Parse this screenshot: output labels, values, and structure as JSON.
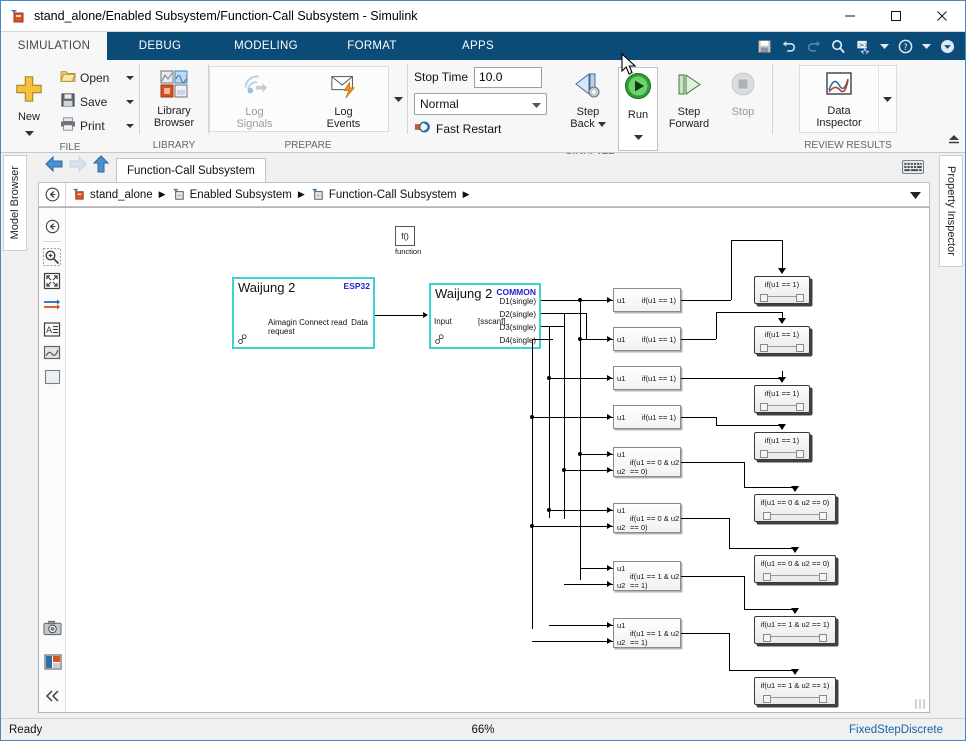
{
  "window": {
    "title": "stand_alone/Enabled Subsystem/Function-Call Subsystem - Simulink",
    "app_icon": "simulink-icon",
    "minimize": "—",
    "maximize": "☐",
    "close": "✕"
  },
  "ribbon": {
    "tabs": [
      {
        "label": "SIMULATION",
        "active": true
      },
      {
        "label": "DEBUG",
        "active": false
      },
      {
        "label": "MODELING",
        "active": false
      },
      {
        "label": "FORMAT",
        "active": false
      },
      {
        "label": "APPS",
        "active": false
      }
    ],
    "quick_access": [
      "save-icon",
      "undo-icon",
      "redo-icon",
      "search-icon",
      "shortcuts-icon",
      "shortcuts-caret",
      "help-icon",
      "help-caret",
      "collapse-ribbon-icon"
    ],
    "groups": [
      {
        "name": "FILE",
        "label": "FILE",
        "big": {
          "label": "New",
          "icon": "new-plus-icon"
        },
        "items": [
          {
            "label": "Open",
            "icon": "folder-open-icon",
            "has_caret": true
          },
          {
            "label": "Save",
            "icon": "floppy-save-icon",
            "has_caret": true
          },
          {
            "label": "Print",
            "icon": "printer-icon",
            "has_caret": true
          }
        ]
      },
      {
        "name": "LIBRARY",
        "label": "LIBRARY",
        "big": {
          "label": "Library\nBrowser",
          "line1": "Library",
          "line2": "Browser",
          "icon": "library-browser-icon"
        }
      },
      {
        "name": "PREPARE",
        "label": "PREPARE",
        "items": [
          {
            "line1": "Log",
            "line2": "Signals",
            "icon": "log-signals-icon",
            "disabled": true
          },
          {
            "line1": "Log",
            "line2": "Events",
            "icon": "log-events-icon",
            "disabled": false
          }
        ],
        "overflow_caret": true
      },
      {
        "name": "SIMULATE",
        "label": "SIMULATE",
        "stop_time_label": "Stop Time",
        "stop_time_value": "10.0",
        "mode_value": "Normal",
        "fast_restart_label": "Fast Restart",
        "buttons": [
          {
            "line1": "Step",
            "line2": "Back",
            "icon": "step-back-icon",
            "has_caret": true,
            "disabled": false
          },
          {
            "line1": "Run",
            "line2": "",
            "icon": "run-icon",
            "has_caret": true,
            "disabled": false,
            "highlight": true
          },
          {
            "line1": "Step",
            "line2": "Forward",
            "icon": "step-forward-icon",
            "has_caret": false,
            "disabled": false
          },
          {
            "line1": "Stop",
            "line2": "",
            "icon": "stop-icon",
            "has_caret": false,
            "disabled": true
          }
        ]
      },
      {
        "name": "REVIEW RESULTS",
        "label": "REVIEW RESULTS",
        "big": {
          "line1": "Data",
          "line2": "Inspector",
          "icon": "data-inspector-icon",
          "has_caret": true
        }
      }
    ]
  },
  "panels": {
    "left_tab": "Model Browser",
    "right_tab": "Property Inspector"
  },
  "nav": {
    "back_icon": "back-arrow-icon",
    "forward_icon": "forward-arrow-icon",
    "up_icon": "up-arrow-icon",
    "document_tab": "Function-Call Subsystem",
    "keyboard_icon": "keyboard-icon",
    "breadcrumb_back_icon": "breadcrumb-back-icon",
    "breadcrumb": [
      {
        "label": "stand_alone",
        "icon": "model-icon"
      },
      {
        "label": "Enabled Subsystem",
        "icon": "subsystem-icon"
      },
      {
        "label": "Function-Call Subsystem",
        "icon": "subsystem-icon"
      }
    ],
    "breadcrumb_caret": "chevron-down-icon"
  },
  "canvas_toolbar": {
    "items": [
      {
        "name": "navigate-up-icon"
      },
      {
        "name": "zoom-in-icon"
      },
      {
        "name": "fit-to-view-icon"
      },
      {
        "name": "signal-lines-icon"
      },
      {
        "name": "annotation-icon"
      },
      {
        "name": "image-icon"
      },
      {
        "name": "area-icon"
      }
    ],
    "bottom_items": [
      {
        "name": "camera-icon"
      },
      {
        "name": "layout-icon"
      },
      {
        "name": "collapse-icon"
      }
    ]
  },
  "diagram": {
    "function_block": {
      "glyph": "f()",
      "label": "function"
    },
    "source_block": {
      "title": "Waijung 2",
      "badge": "ESP32",
      "text": "Aimagin Connect read request",
      "out_port": "Data",
      "link_icon": "library-link-icon"
    },
    "parser_block": {
      "title": "Waijung 2",
      "badge": "COMMON",
      "in_port": "Input",
      "mid": "[sscanf]",
      "out_ports": [
        "D1(single)",
        "D2(single)",
        "D3(single)",
        "D4(single)"
      ],
      "link_icon": "library-link-icon"
    },
    "if_blocks": [
      {
        "ports": [
          "u1"
        ],
        "condition": "if(u1 == 1)"
      },
      {
        "ports": [
          "u1"
        ],
        "condition": "if(u1 == 1)"
      },
      {
        "ports": [
          "u1"
        ],
        "condition": "if(u1 == 1)"
      },
      {
        "ports": [
          "u1"
        ],
        "condition": "if(u1 == 1)"
      },
      {
        "ports": [
          "u1",
          "u2"
        ],
        "condition": "if(u1 == 0 & u2 == 0)"
      },
      {
        "ports": [
          "u1",
          "u2"
        ],
        "condition": "if(u1 == 0 & u2 == 0)"
      },
      {
        "ports": [
          "u1",
          "u2"
        ],
        "condition": "if(u1 == 1 & u2 == 1)"
      },
      {
        "ports": [
          "u1",
          "u2"
        ],
        "condition": "if(u1 == 1 & u2 == 1)"
      }
    ],
    "action_subsystems": [
      {
        "label": "if(u1 == 1)"
      },
      {
        "label": "if(u1 == 1)"
      },
      {
        "label": "if(u1 == 1)"
      },
      {
        "label": "if(u1 == 1)"
      },
      {
        "label": "if(u1 == 0 & u2 == 0)"
      },
      {
        "label": "if(u1 == 0 & u2 == 0)"
      },
      {
        "label": "if(u1 == 1 & u2 == 1)"
      },
      {
        "label": "if(u1 == 1 & u2 == 1)"
      }
    ]
  },
  "status": {
    "ready": "Ready",
    "zoom": "66%",
    "solver": "FixedStepDiscrete"
  },
  "colors": {
    "ribbon_blue": "#0b4b78",
    "accent_cyan": "#3fd2d2",
    "badge_blue": "#2222cc",
    "link_blue": "#1464a8"
  }
}
